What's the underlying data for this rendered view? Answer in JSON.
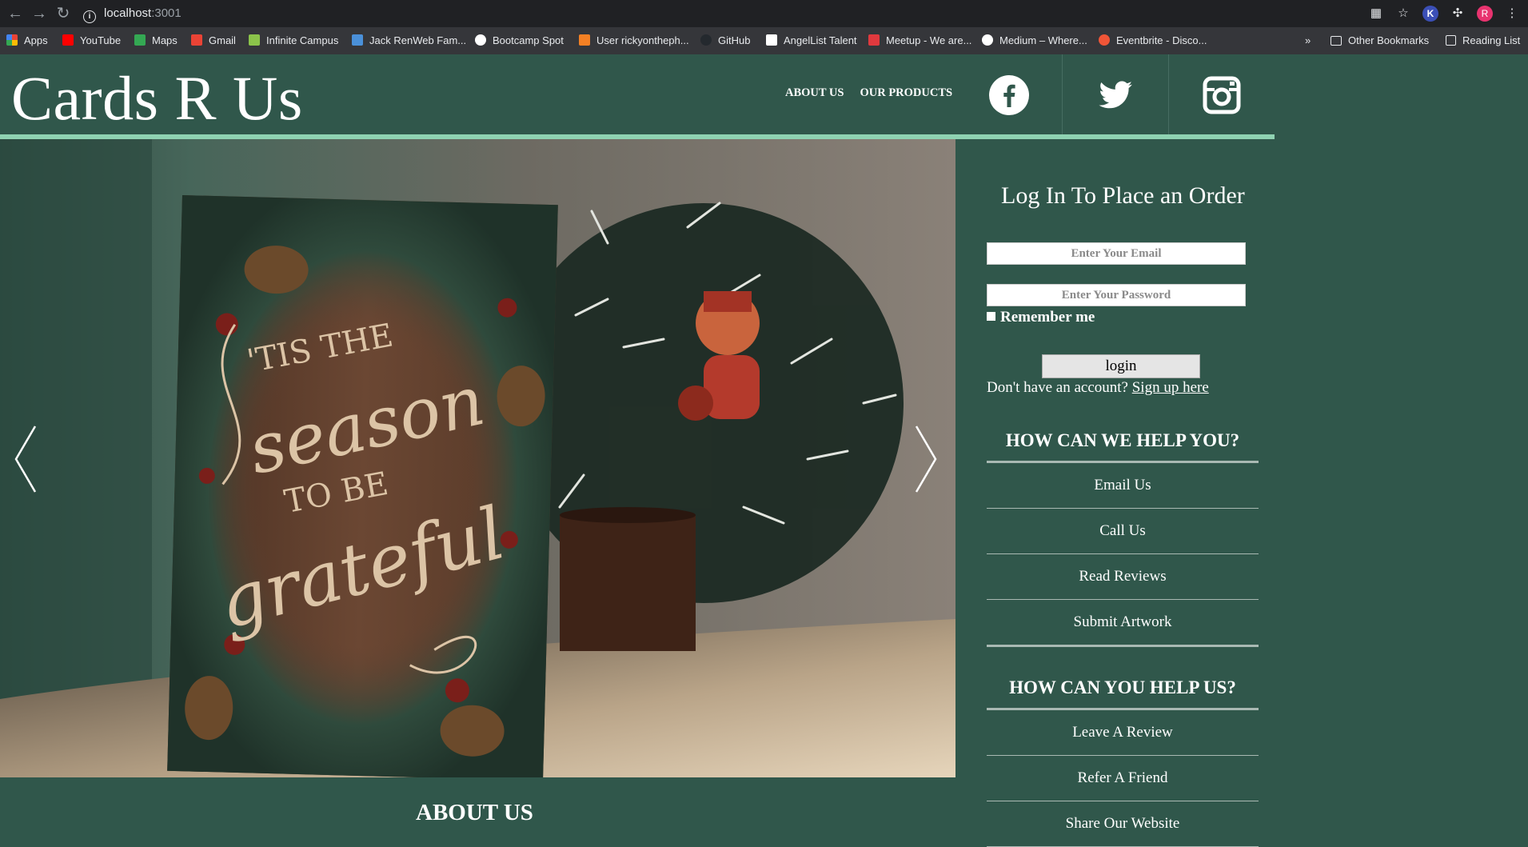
{
  "browser": {
    "url_host": "localhost",
    "url_port": ":3001",
    "bookmarks": [
      {
        "label": "Apps",
        "color": "#e8453c"
      },
      {
        "label": "YouTube",
        "color": "#ff0000"
      },
      {
        "label": "Maps",
        "color": "#34a853"
      },
      {
        "label": "Gmail",
        "color": "#ea4335"
      },
      {
        "label": "Infinite Campus",
        "color": "#8bc34a"
      },
      {
        "label": "Jack RenWeb Fam...",
        "color": "#4a90d9"
      },
      {
        "label": "Bootcamp Spot",
        "color": "#ffffff"
      },
      {
        "label": "User rickyontheph...",
        "color": "#f48024"
      },
      {
        "label": "GitHub",
        "color": "#24292e"
      },
      {
        "label": "AngelList Talent",
        "color": "#ffffff"
      },
      {
        "label": "Meetup - We are...",
        "color": "#e0393e"
      },
      {
        "label": "Medium – Where...",
        "color": "#ffffff"
      },
      {
        "label": "Eventbrite - Disco...",
        "color": "#f05537"
      }
    ],
    "other_bookmarks": "Other Bookmarks",
    "reading_list": "Reading List",
    "profile_initial": "R",
    "ext_initial": "K"
  },
  "site": {
    "logo": "Cards R Us",
    "nav": [
      "ABOUT US",
      "OUR PRODUCTS"
    ],
    "social": [
      "facebook",
      "twitter",
      "instagram"
    ]
  },
  "carousel": {
    "card_text_line1": "'TIS THE",
    "card_text_line2": "season",
    "card_text_line3": "TO BE",
    "card_text_line4": "grateful"
  },
  "login": {
    "title": "Log In To Place an Order",
    "email_placeholder": "Enter Your Email",
    "password_placeholder": "Enter Your Password",
    "remember": "Remember me",
    "button": "login",
    "no_account": "Don't have an account?",
    "signup_link": "Sign up here"
  },
  "help_you": {
    "title": "HOW CAN WE HELP YOU?",
    "items": [
      "Email Us",
      "Call Us",
      "Read Reviews",
      "Submit Artwork"
    ]
  },
  "help_us": {
    "title": "HOW CAN YOU HELP US?",
    "items": [
      "Leave A Review",
      "Refer A Friend",
      "Share Our Website"
    ]
  },
  "about": {
    "title": "ABOUT US"
  },
  "colors": {
    "page_bg": "#30574b",
    "accent_rule": "#8fd2b2"
  }
}
